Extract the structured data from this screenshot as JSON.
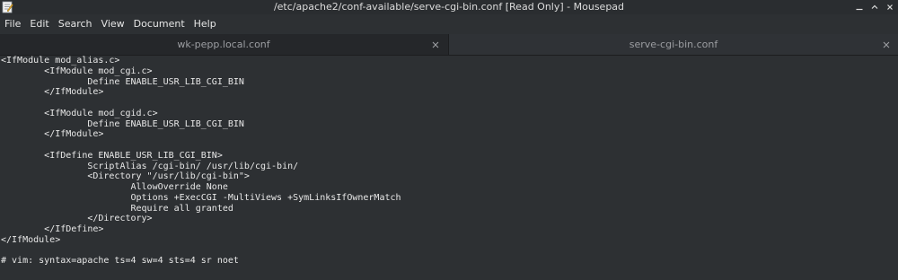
{
  "window": {
    "title": "/etc/apache2/conf-available/serve-cgi-bin.conf [Read Only] - Mousepad",
    "app_icon": "mousepad-icon",
    "buttons": [
      "minimize-icon",
      "maximize-icon",
      "close-icon"
    ]
  },
  "menubar": {
    "items": [
      "File",
      "Edit",
      "Search",
      "View",
      "Document",
      "Help"
    ]
  },
  "tabs": [
    {
      "label": "wk-pepp.local.conf",
      "active": false,
      "close_icon": "close-icon"
    },
    {
      "label": "serve-cgi-bin.conf",
      "active": true,
      "close_icon": "close-icon"
    }
  ],
  "editor": {
    "lines": [
      "<IfModule mod_alias.c>",
      "\t<IfModule mod_cgi.c>",
      "\t\tDefine ENABLE_USR_LIB_CGI_BIN",
      "\t</IfModule>",
      "",
      "\t<IfModule mod_cgid.c>",
      "\t\tDefine ENABLE_USR_LIB_CGI_BIN",
      "\t</IfModule>",
      "",
      "\t<IfDefine ENABLE_USR_LIB_CGI_BIN>",
      "\t\tScriptAlias /cgi-bin/ /usr/lib/cgi-bin/",
      "\t\t<Directory \"/usr/lib/cgi-bin\">",
      "\t\t\tAllowOverride None",
      "\t\t\tOptions +ExecCGI -MultiViews +SymLinksIfOwnerMatch",
      "\t\t\tRequire all granted",
      "\t\t</Directory>",
      "\t</IfDefine>",
      "</IfModule>",
      "",
      "# vim: syntax=apache ts=4 sw=4 sts=4 sr noet"
    ]
  },
  "colors": {
    "background": "#2d3033",
    "text": "#e8e8e8",
    "tab_inactive_text": "#9c9ea2"
  }
}
